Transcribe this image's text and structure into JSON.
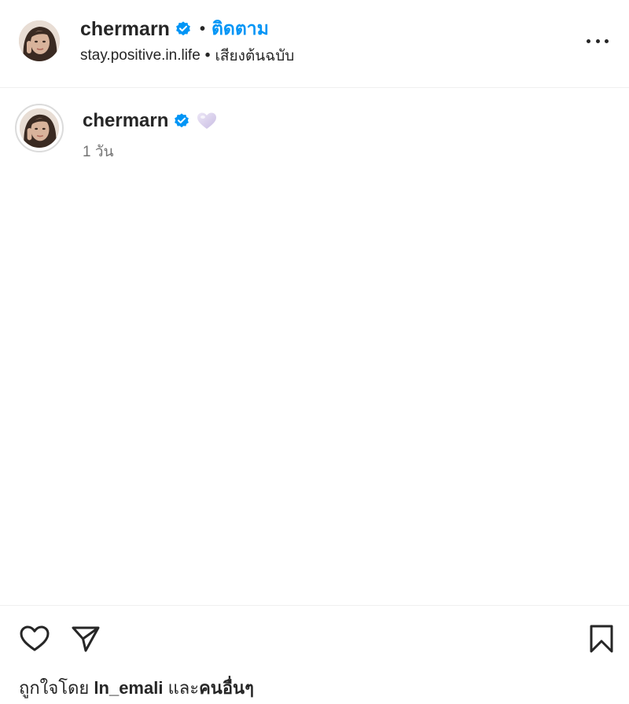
{
  "header": {
    "username": "chermarn",
    "verified_icon": "verified-badge-icon",
    "follow_label": "ติดตาม",
    "audio_source": "stay.positive.in.life",
    "audio_label": "เสียงต้นฉบับ",
    "more_icon": "more-options-icon"
  },
  "comment": {
    "username": "chermarn",
    "text_emoji": "lilac-heart-emoji",
    "time": "1 วัน"
  },
  "actions": {
    "like_icon": "heart-icon",
    "share_icon": "paper-plane-icon",
    "save_icon": "bookmark-icon"
  },
  "likes": {
    "prefix": "ถูกใจโดย",
    "liker": "ln_emali",
    "and": "และ",
    "others": "คนอื่นๆ"
  },
  "colors": {
    "accent": "#0095f6",
    "text": "#262626",
    "secondary": "#737373",
    "divider": "#efefef"
  }
}
